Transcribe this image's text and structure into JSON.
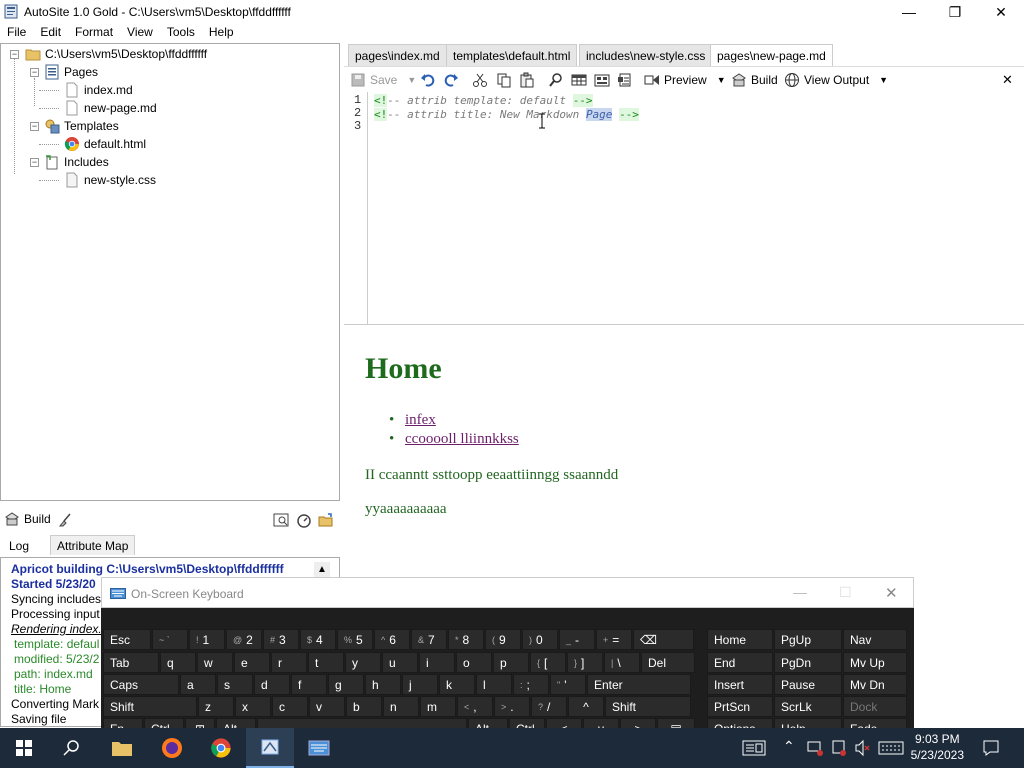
{
  "window": {
    "title": "AutoSite 1.0 Gold - C:\\Users\\vm5\\Desktop\\ffddffffff",
    "minimize_glyph": "—",
    "maximize_glyph": "❐",
    "close_glyph": "✕"
  },
  "menu": [
    "File",
    "Edit",
    "Format",
    "View",
    "Tools",
    "Help"
  ],
  "tree": {
    "root": "C:\\Users\\vm5\\Desktop\\ffddffffff",
    "pages_label": "Pages",
    "pages": [
      "index.md",
      "new-page.md"
    ],
    "templates_label": "Templates",
    "templates": [
      "default.html"
    ],
    "includes_label": "Includes",
    "includes": [
      "new-style.css"
    ]
  },
  "build_panel": {
    "build_label": "Build",
    "tabs": [
      "Log",
      "Attribute Map"
    ],
    "log": [
      "Apricot building C:\\Users\\vm5\\Desktop\\ffddffffff",
      "Started 5/23/20",
      "Syncing includes",
      "Processing input",
      "Rendering index.",
      "template: defaul",
      "modified: 5/23/2",
      "path: index.md",
      "title: Home",
      "Converting Mark",
      "Saving file"
    ]
  },
  "editor_tabs": [
    "pages\\index.md",
    "templates\\default.html",
    "includes\\new-style.css",
    "pages\\new-page.md"
  ],
  "toolbar": {
    "save": "Save",
    "preview": "Preview",
    "build": "Build",
    "view_output": "View Output",
    "close_glyph": "✕"
  },
  "code": {
    "line_numbers": [
      "1",
      "2",
      "3"
    ],
    "line1": {
      "open": "<!",
      "body": "-- attrib template: default ",
      "close": "-->"
    },
    "line2": {
      "open": "<!",
      "body": "-- attrib title: New Markdown ",
      "selected": "Page",
      "rest": " ",
      "close": "-->"
    }
  },
  "preview": {
    "heading": "Home",
    "links": [
      "infex",
      "ccooooll lliinnkkss"
    ],
    "paragraphs": [
      "II ccaanntt ssttoopp eeaattiinngg ssaanndd",
      "yyaaaaaaaaaa"
    ]
  },
  "osk": {
    "title": "On-Screen Keyboard",
    "row1": [
      {
        "sub": "~ `",
        "key": ""
      },
      {
        "sub": "!",
        "key": "1"
      },
      {
        "sub": "@",
        "key": "2"
      },
      {
        "sub": "#",
        "key": "3"
      },
      {
        "sub": "$",
        "key": "4"
      },
      {
        "sub": "%",
        "key": "5"
      },
      {
        "sub": "^",
        "key": "6"
      },
      {
        "sub": "&",
        "key": "7"
      },
      {
        "sub": "*",
        "key": "8"
      },
      {
        "sub": "(",
        "key": "9"
      },
      {
        "sub": ")",
        "key": "0"
      },
      {
        "sub": "_",
        "key": "-"
      },
      {
        "sub": "+",
        "key": "="
      }
    ],
    "esc": "Esc",
    "backspace": "⌫",
    "row2": [
      "q",
      "w",
      "e",
      "r",
      "t",
      "y",
      "u",
      "i",
      "o",
      "p"
    ],
    "row2_extra": [
      {
        "sub": "{",
        "key": "["
      },
      {
        "sub": "}",
        "key": "]"
      },
      {
        "sub": "|",
        "key": "\\"
      }
    ],
    "tab": "Tab",
    "del": "Del",
    "row3": [
      "a",
      "s",
      "d",
      "f",
      "g",
      "h",
      "j",
      "k",
      "l"
    ],
    "row3_extra": [
      {
        "sub": ":",
        "key": ";"
      },
      {
        "sub": "\"",
        "key": "'"
      }
    ],
    "caps": "Caps",
    "enter": "Enter",
    "row4": [
      "z",
      "x",
      "c",
      "v",
      "b",
      "n",
      "m"
    ],
    "row4_extra": [
      {
        "sub": "<",
        "key": ","
      },
      {
        "sub": ">",
        "key": "."
      },
      {
        "sub": "?",
        "key": "/"
      }
    ],
    "shift": "Shift",
    "up": "^",
    "row5": [
      "Fn",
      "Ctrl",
      "⊞",
      "Alt"
    ],
    "alt_r": "Alt",
    "ctrl_r": "Ctrl",
    "left": "<",
    "down": "v",
    "right": ">",
    "menu_key": "▤",
    "nav": [
      [
        "Home",
        "PgUp",
        "Nav"
      ],
      [
        "End",
        "PgDn",
        "Mv Up"
      ],
      [
        "Insert",
        "Pause",
        "Mv Dn"
      ],
      [
        "PrtScn",
        "ScrLk",
        "Dock"
      ],
      [
        "Options",
        "Help",
        "Fade"
      ]
    ]
  },
  "taskbar": {
    "time": "9:03 PM",
    "date": "5/23/2023"
  }
}
